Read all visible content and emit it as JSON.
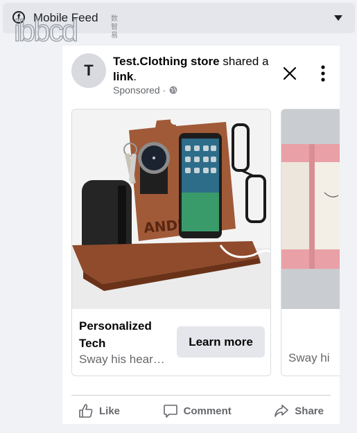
{
  "app": {
    "title": "Mobile Feed",
    "watermark": "ibbcd",
    "watermark_cn": "数智易"
  },
  "post": {
    "avatar_initial": "T",
    "page_name": "Test.Clothing store",
    "action_text": " shared a ",
    "object_text": "link",
    "object_suffix": ".",
    "sponsored": "Sponsored ·"
  },
  "carousel": {
    "items": [
      {
        "image": "wooden docking station with watch, keys, phone and glasses",
        "image_engraving": "ANDREW",
        "headline": "Personalized Tech",
        "description": "Sway his hear…",
        "cta": "Learn more"
      },
      {
        "image": "open pink book",
        "description": "Sway hi"
      }
    ]
  },
  "actions": {
    "like": "Like",
    "comment": "Comment",
    "share": "Share"
  },
  "colors": {
    "page_bg": "#f0f2f5",
    "card_bg": "#ffffff",
    "secondary_text": "#65676b",
    "button_bg": "#e4e6eb"
  }
}
